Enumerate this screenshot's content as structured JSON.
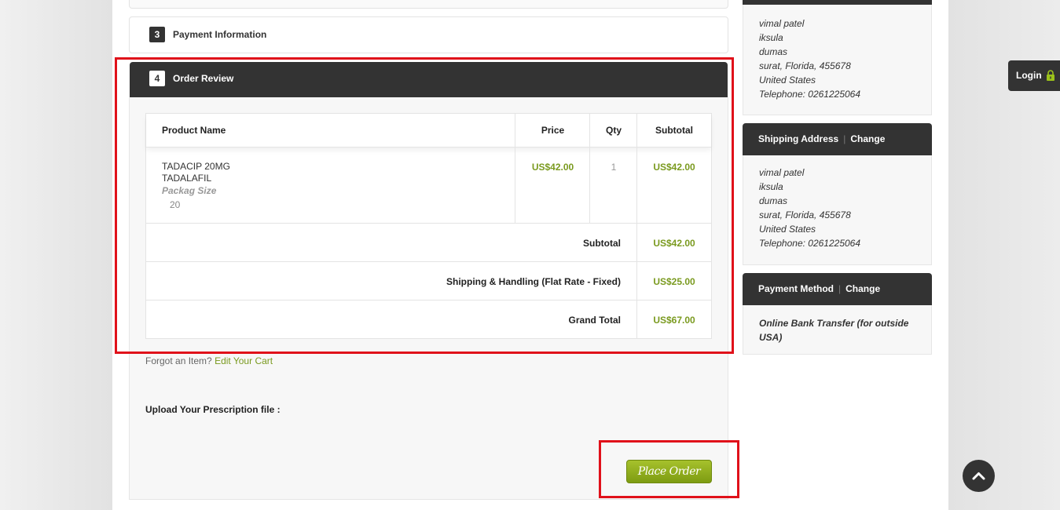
{
  "steps": {
    "step3": {
      "number": "3",
      "title": "Payment Information"
    },
    "step4": {
      "number": "4",
      "title": "Order Review"
    }
  },
  "review_table": {
    "headers": {
      "product": "Product Name",
      "price": "Price",
      "qty": "Qty",
      "subtotal": "Subtotal"
    },
    "items": [
      {
        "name_line1": "TADACIP 20MG",
        "name_line2": "TADALAFIL",
        "option_label": "Packag Size",
        "option_value": "20",
        "price": "US$42.00",
        "qty": "1",
        "subtotal": "US$42.00"
      }
    ],
    "totals": [
      {
        "label": "Subtotal",
        "value": "US$42.00"
      },
      {
        "label": "Shipping & Handling (Flat Rate - Fixed)",
        "value": "US$25.00"
      },
      {
        "label": "Grand Total",
        "value": "US$67.00"
      }
    ]
  },
  "forgot": {
    "text": "Forgot an Item?",
    "link": "Edit Your Cart"
  },
  "upload_label": "Upload Your Prescription file :",
  "place_order_label": "Place Order",
  "sidebar": {
    "billing_address": [
      "vimal patel",
      "iksula",
      "dumas",
      "surat, Florida, 455678",
      "United States",
      "Telephone: 0261225064"
    ],
    "shipping": {
      "title": "Shipping Address",
      "change": "Change",
      "address": [
        "vimal patel",
        "iksula",
        "dumas",
        "surat, Florida, 455678",
        "United States",
        "Telephone: 0261225064"
      ]
    },
    "payment": {
      "title": "Payment Method",
      "change": "Change",
      "method": "Online Bank Transfer (for outside USA)"
    }
  },
  "login_label": "Login",
  "colors": {
    "accent_green": "#7a9a1f",
    "dark": "#333333",
    "highlight_red": "#e0111a"
  }
}
